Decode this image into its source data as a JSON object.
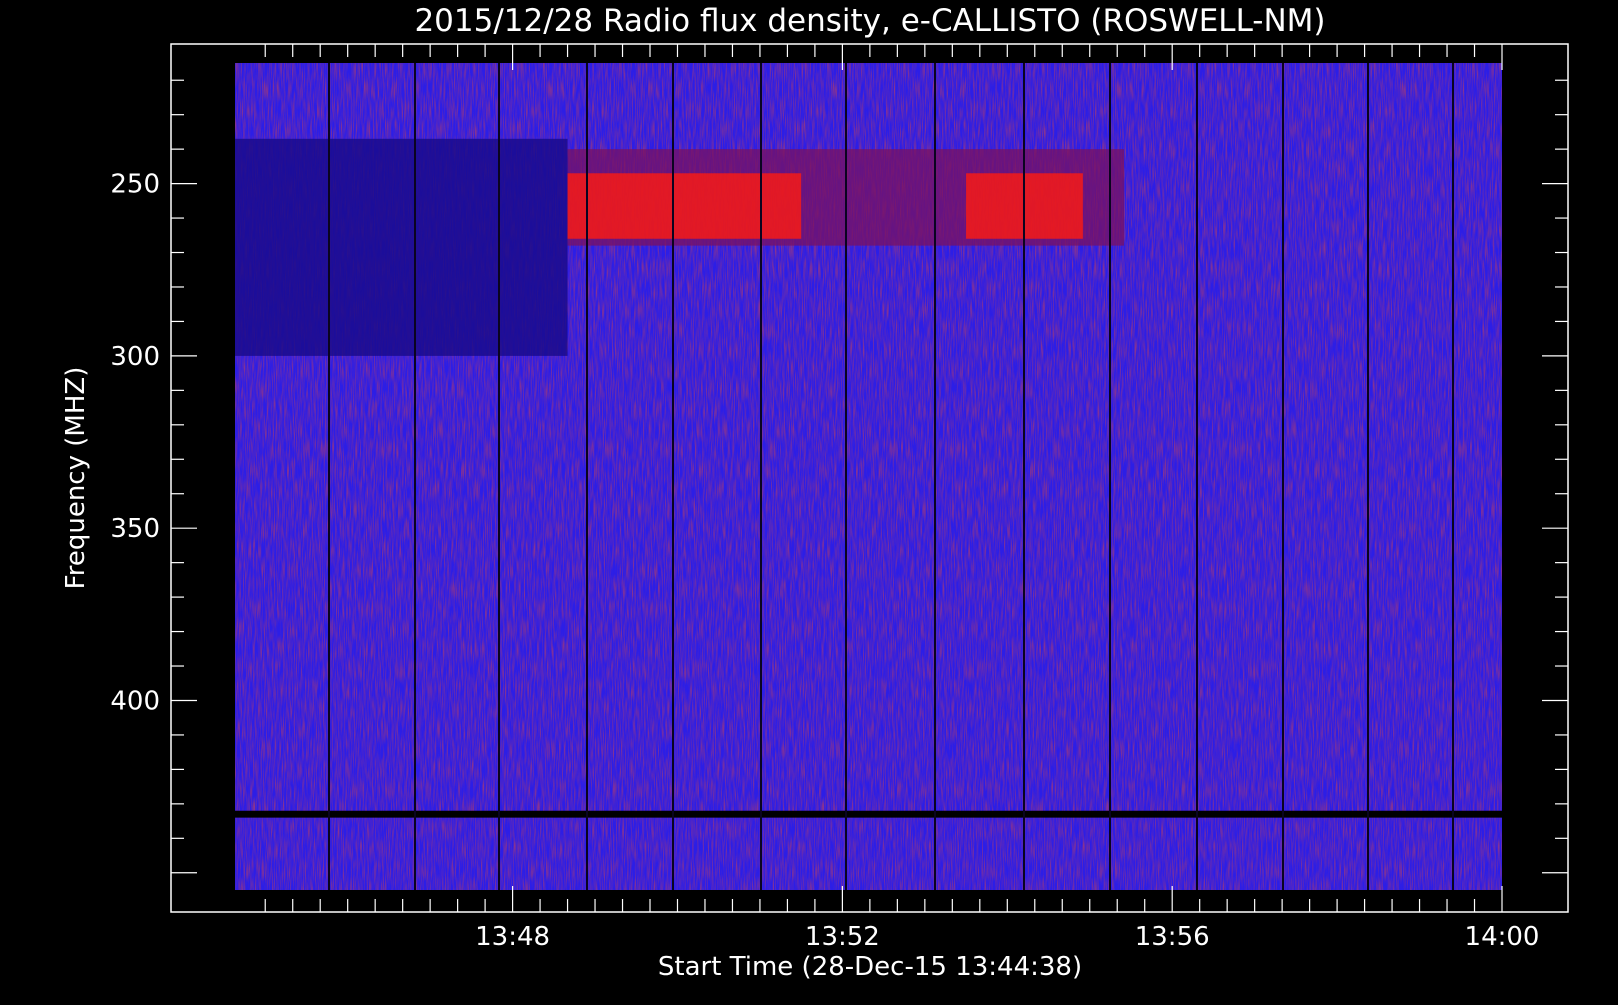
{
  "chart_data": {
    "type": "heatmap",
    "title": "2015/12/28  Radio flux density, e-CALLISTO (ROSWELL-NM)",
    "xlabel": "Start Time (28-Dec-15 13:44:38)",
    "ylabel": "Frequency (MHZ)",
    "x_tick_labels": [
      "13:48",
      "13:52",
      "13:56",
      "14:00"
    ],
    "y_tick_labels": [
      "250",
      "300",
      "350",
      "400"
    ],
    "y_ticks": [
      250,
      300,
      350,
      400
    ],
    "ylim_top_to_bottom": [
      215,
      455
    ],
    "colors": {
      "background": "#000000",
      "axis": "#ffffff",
      "low_intensity": "#1a0a8c",
      "background_intensity": "#2c1ee6",
      "high_intensity": "#ff1a10"
    },
    "features": [
      {
        "kind": "dark band",
        "start": "13:44:38",
        "end": "13:48:40",
        "freq_mhz": [
          237,
          300
        ]
      },
      {
        "kind": "emission",
        "start": "13:48:40",
        "end": "13:55:25",
        "freq_mhz": [
          240,
          268
        ]
      },
      {
        "kind": "strong emission",
        "start": "13:48:40",
        "end": "13:51:30",
        "freq_mhz": [
          247,
          266
        ]
      },
      {
        "kind": "strong emission",
        "start": "13:53:30",
        "end": "13:54:55",
        "freq_mhz": [
          247,
          266
        ]
      },
      {
        "kind": "interference band",
        "start": "13:44:38",
        "end": "14:00:00",
        "freq_mhz": [
          432,
          434
        ]
      }
    ]
  }
}
